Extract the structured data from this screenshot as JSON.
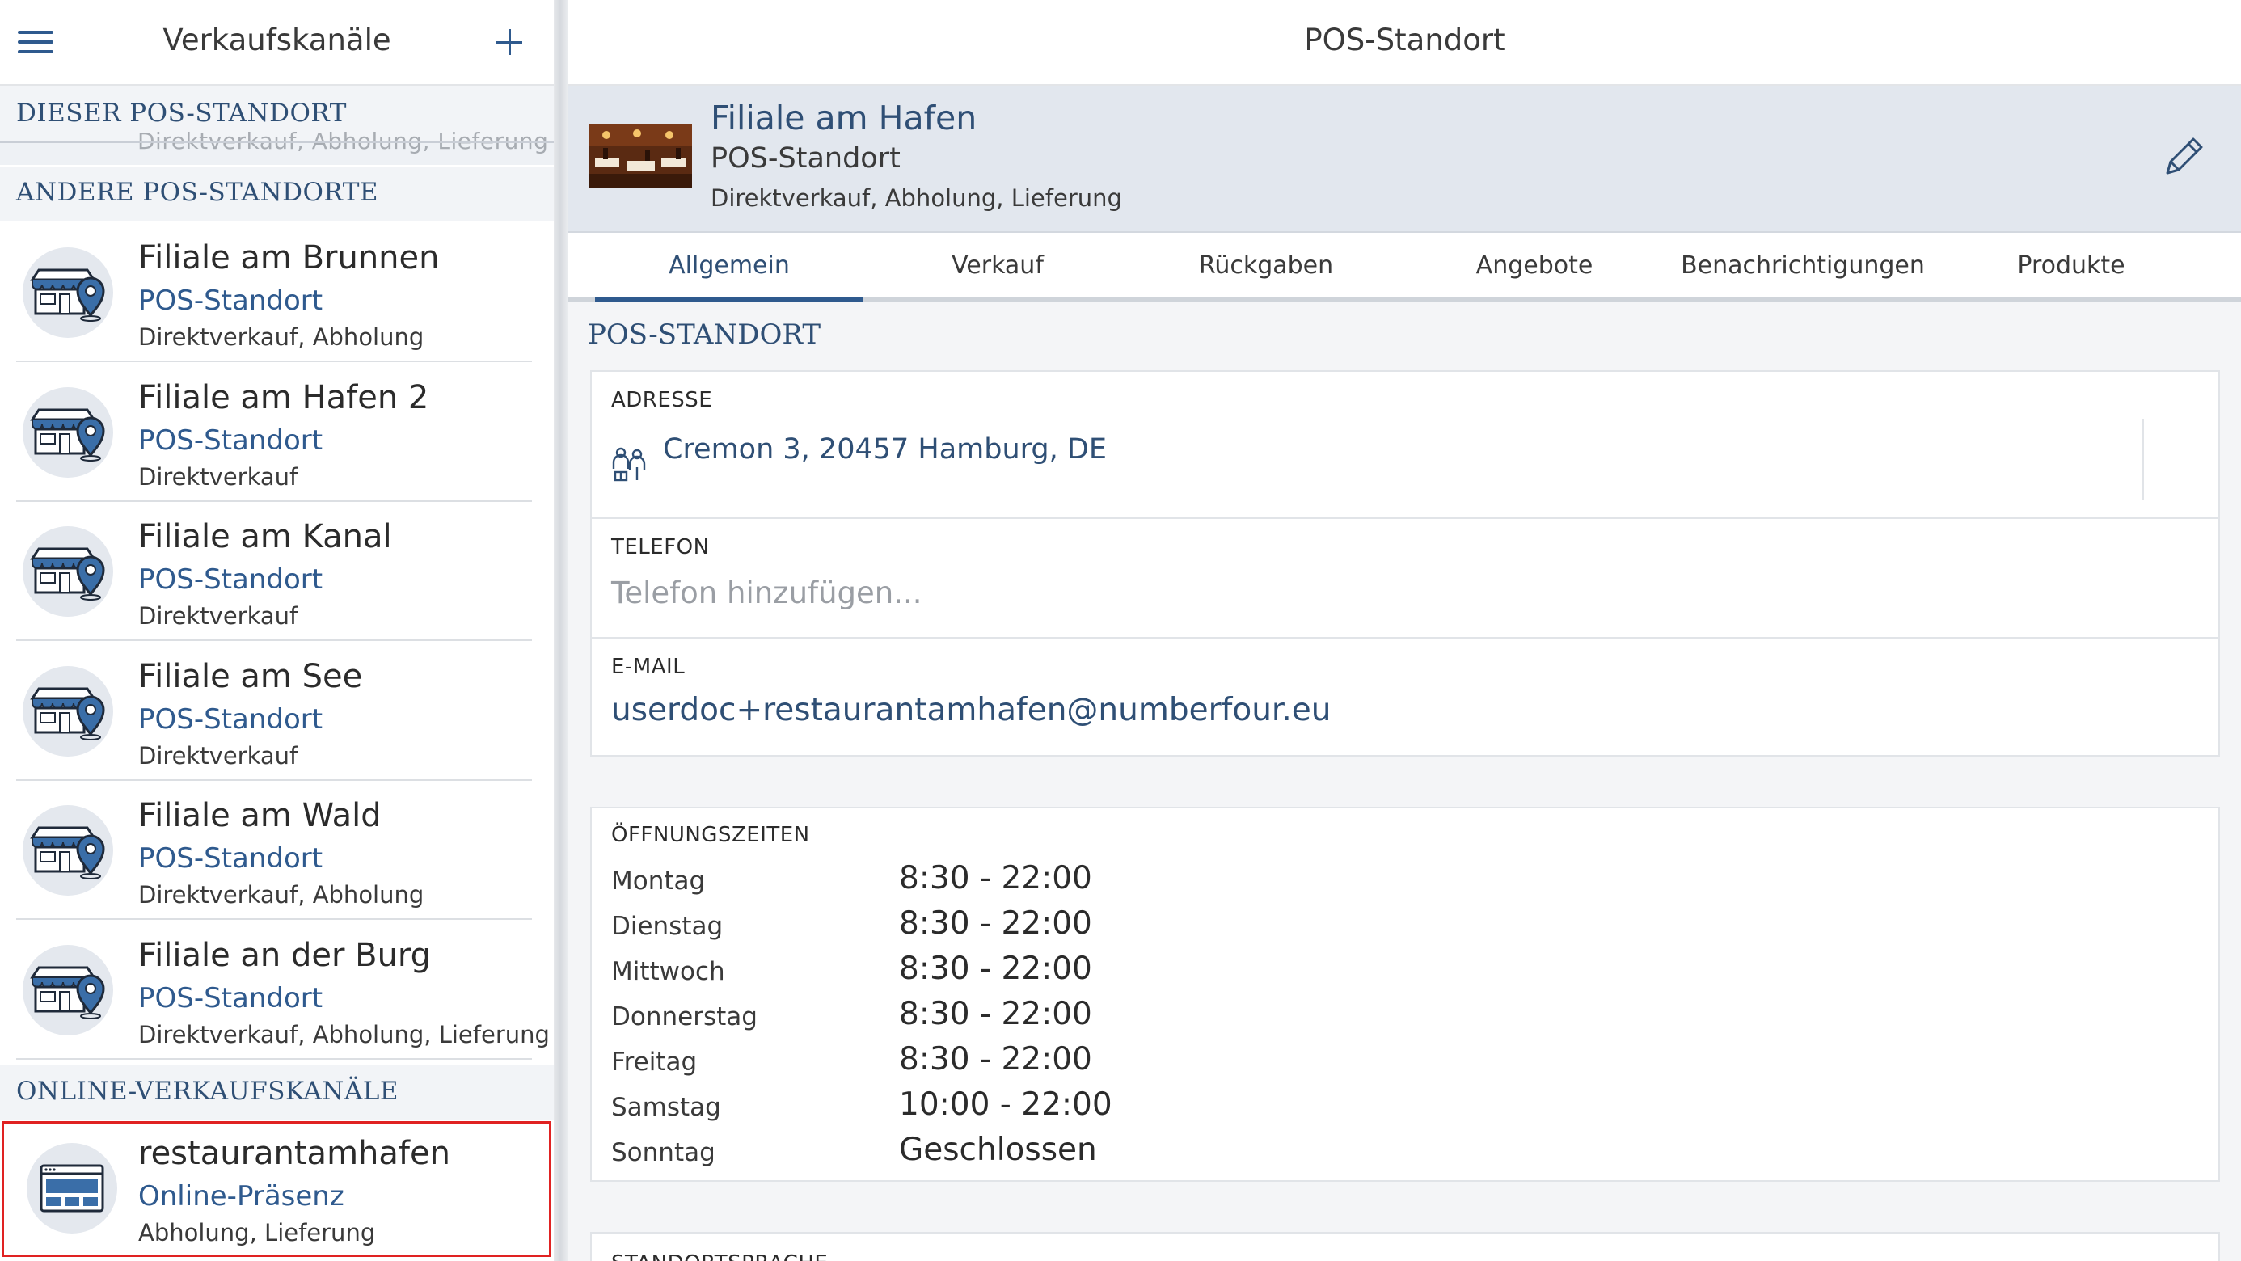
{
  "left": {
    "title": "Verkaufskanäle",
    "section_this": "DIESER POS-STANDORT",
    "section_this_ghost": "Direktverkauf, Abholung, Lieferung",
    "section_other": "ANDERE POS-STANDORTE",
    "section_online": "ONLINE-VERKAUFSKANÄLE",
    "stores": [
      {
        "name": "Filiale am Brunnen",
        "type": "POS-Standort",
        "desc": "Direktverkauf, Abholung"
      },
      {
        "name": "Filiale am Hafen 2",
        "type": "POS-Standort",
        "desc": "Direktverkauf"
      },
      {
        "name": "Filiale am Kanal",
        "type": "POS-Standort",
        "desc": "Direktverkauf"
      },
      {
        "name": "Filiale am See",
        "type": "POS-Standort",
        "desc": "Direktverkauf"
      },
      {
        "name": "Filiale am Wald",
        "type": "POS-Standort",
        "desc": "Direktverkauf, Abholung"
      },
      {
        "name": "Filiale an der Burg",
        "type": "POS-Standort",
        "desc": "Direktverkauf, Abholung, Lieferung"
      }
    ],
    "online": {
      "name": "restaurantamhafen",
      "type": "Online-Präsenz",
      "desc": "Abholung, Lieferung"
    }
  },
  "right": {
    "title": "POS-Standort",
    "hero": {
      "title": "Filiale am Hafen",
      "type": "POS-Standort",
      "desc": "Direktverkauf, Abholung, Lieferung"
    },
    "tabs": [
      "Allgemein",
      "Verkauf",
      "Rückgaben",
      "Angebote",
      "Benachrichtigungen",
      "Produkte"
    ],
    "active_tab": "Allgemein",
    "section_title": "POS-STANDORT",
    "address": {
      "label": "ADRESSE",
      "value": "Cremon 3, 20457 Hamburg, DE"
    },
    "phone": {
      "label": "TELEFON",
      "placeholder": "Telefon hinzufügen..."
    },
    "email": {
      "label": "E-MAIL",
      "value": "userdoc+restaurantamhafen@numberfour.eu"
    },
    "hours": {
      "label": "ÖFFNUNGSZEITEN",
      "rows": [
        {
          "day": "Montag",
          "time": "8:30 - 22:00"
        },
        {
          "day": "Dienstag",
          "time": "8:30 - 22:00"
        },
        {
          "day": "Mittwoch",
          "time": "8:30 - 22:00"
        },
        {
          "day": "Donnerstag",
          "time": "8:30 - 22:00"
        },
        {
          "day": "Freitag",
          "time": "8:30 - 22:00"
        },
        {
          "day": "Samstag",
          "time": "10:00 - 22:00"
        },
        {
          "day": "Sonntag",
          "time": "Geschlossen"
        }
      ]
    },
    "language_label": "STANDORTSPRACHE"
  },
  "colors": {
    "accent": "#2f5a8e",
    "title_blue": "#2f4f75",
    "selection_border": "#e02222",
    "hero_bg": "#e2e7ee"
  },
  "icons": {
    "menu": "hamburger-menu-icon",
    "add": "plus-icon",
    "edit": "pencil-icon",
    "store": "store-location-icon",
    "online": "web-browser-icon",
    "address": "people-location-icon"
  }
}
